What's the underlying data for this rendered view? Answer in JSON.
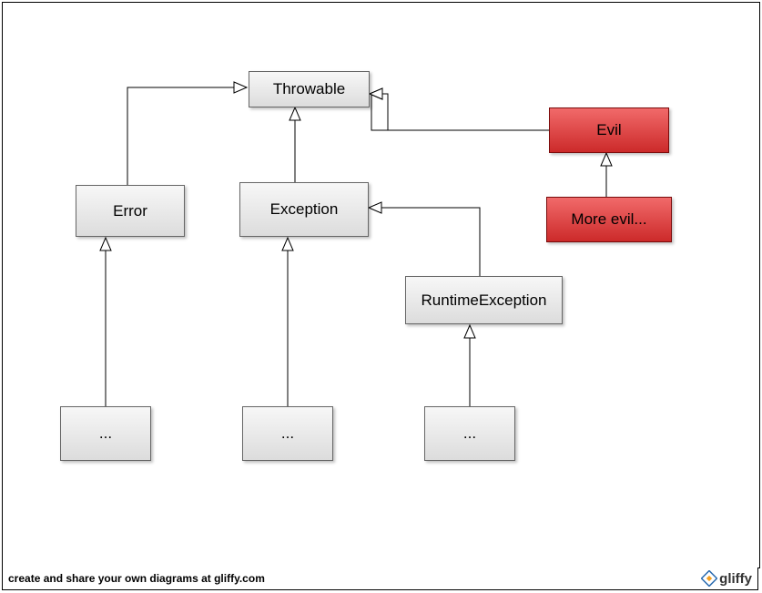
{
  "chart_data": {
    "type": "diagram",
    "title": "",
    "nodes": [
      {
        "id": "throwable",
        "label": "Throwable",
        "style": "gray"
      },
      {
        "id": "error",
        "label": "Error",
        "style": "gray"
      },
      {
        "id": "exception",
        "label": "Exception",
        "style": "gray"
      },
      {
        "id": "runtime",
        "label": "RuntimeException",
        "style": "gray"
      },
      {
        "id": "evil",
        "label": "Evil",
        "style": "red"
      },
      {
        "id": "moreevil",
        "label": "More evil...",
        "style": "red"
      },
      {
        "id": "error_dots",
        "label": "...",
        "style": "gray"
      },
      {
        "id": "exception_dots",
        "label": "...",
        "style": "gray"
      },
      {
        "id": "runtime_dots",
        "label": "...",
        "style": "gray"
      }
    ],
    "edges": [
      {
        "from": "error",
        "to": "throwable",
        "relation": "inherits"
      },
      {
        "from": "exception",
        "to": "throwable",
        "relation": "inherits"
      },
      {
        "from": "evil",
        "to": "throwable",
        "relation": "inherits"
      },
      {
        "from": "moreevil",
        "to": "evil",
        "relation": "inherits"
      },
      {
        "from": "runtime",
        "to": "exception",
        "relation": "inherits"
      },
      {
        "from": "error_dots",
        "to": "error",
        "relation": "inherits"
      },
      {
        "from": "exception_dots",
        "to": "exception",
        "relation": "inherits"
      },
      {
        "from": "runtime_dots",
        "to": "runtime",
        "relation": "inherits"
      }
    ]
  },
  "footer": {
    "text": "create and share your own diagrams at gliffy.com",
    "brand": "gliffy"
  }
}
